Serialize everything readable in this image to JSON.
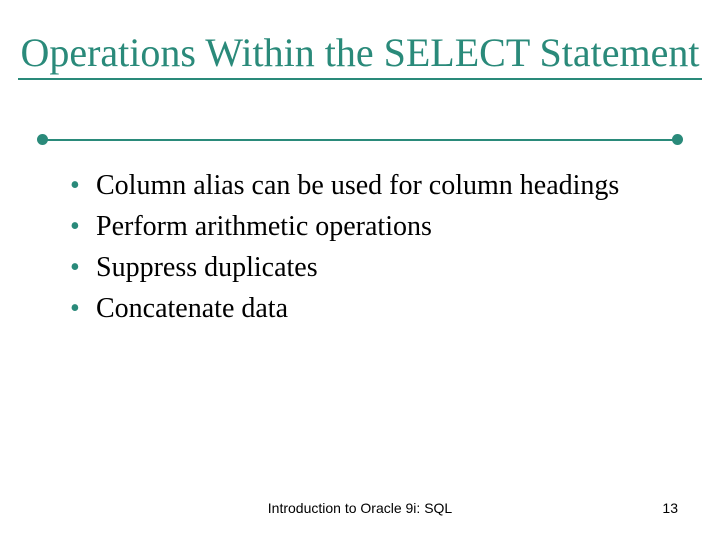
{
  "title": "Operations Within the SELECT Statement",
  "bullets": [
    "Column alias can be used for column headings",
    "Perform arithmetic operations",
    "Suppress duplicates",
    "Concatenate data"
  ],
  "footer": {
    "center": "Introduction to Oracle 9i: SQL",
    "page": "13"
  },
  "colors": {
    "accent": "#2a8a7a"
  }
}
